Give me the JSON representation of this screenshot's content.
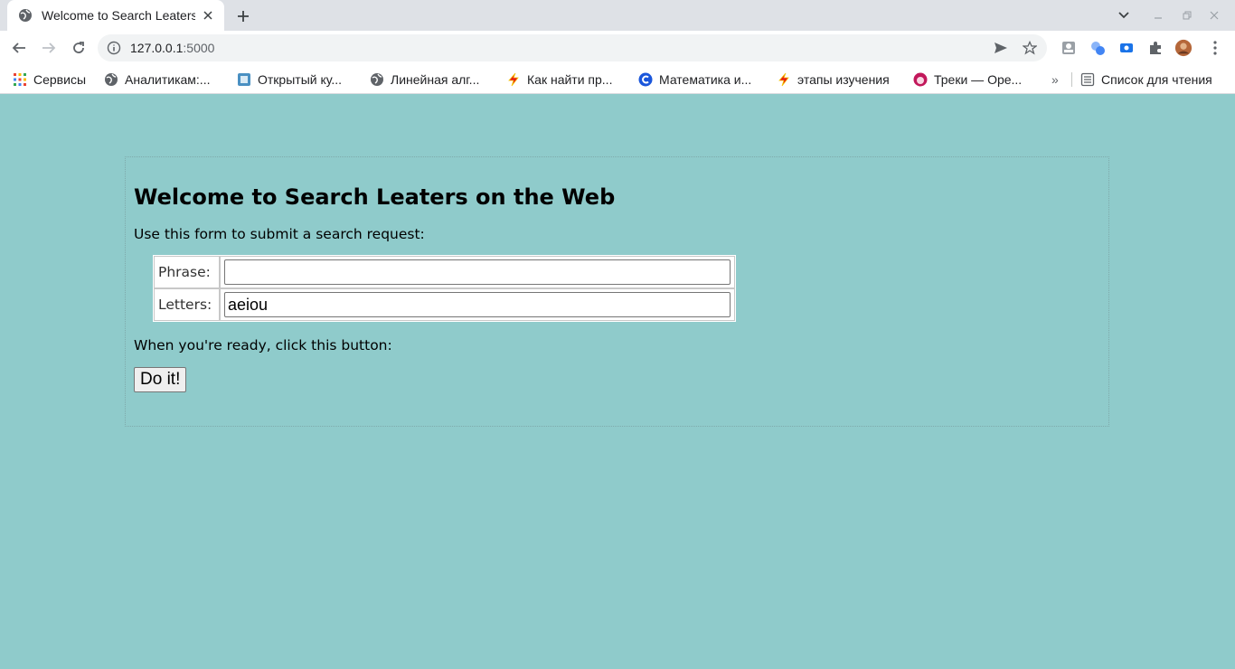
{
  "browser": {
    "tab_title": "Welcome to Search Leaters on the Web",
    "url_host": "127.0.0.1",
    "url_port": ":5000",
    "bookmarks": [
      {
        "label": "Сервисы",
        "icon": "apps-grid-icon"
      },
      {
        "label": "Аналитикам:...",
        "icon": "globe-icon"
      },
      {
        "label": "Открытый ку...",
        "icon": "square-logo-icon"
      },
      {
        "label": "Линейная алг...",
        "icon": "globe-icon"
      },
      {
        "label": "Как найти пр...",
        "icon": "lightning-icon"
      },
      {
        "label": "Математика и...",
        "icon": "c-logo-icon"
      },
      {
        "label": "этапы изучения",
        "icon": "lightning-icon"
      },
      {
        "label": "Треки — Ope...",
        "icon": "avatar-icon"
      }
    ],
    "bookmarks_overflow": "»",
    "reading_list": "Список для чтения"
  },
  "page": {
    "title": "Welcome to Search Leaters on the Web",
    "intro": "Use this form to submit a search request:",
    "phrase_label": "Phrase:",
    "phrase_value": "",
    "letters_label": "Letters:",
    "letters_value": "aeiou",
    "ready_text": "When you're ready, click this button:",
    "submit_label": "Do it!"
  },
  "colors": {
    "page_background": "#8fcbcb",
    "chrome_background": "#dee1e6"
  }
}
